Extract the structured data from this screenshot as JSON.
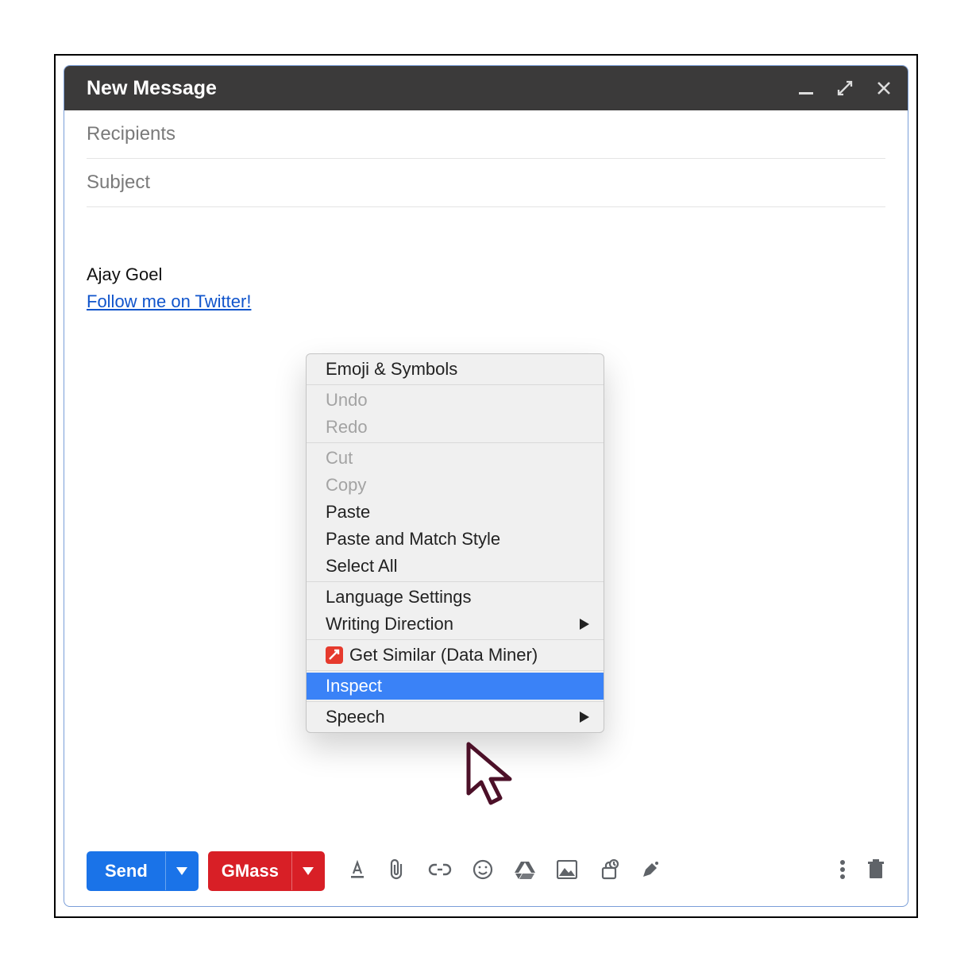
{
  "header": {
    "title": "New Message"
  },
  "fields": {
    "recipients_placeholder": "Recipients",
    "subject_placeholder": "Subject"
  },
  "signature": {
    "name": "Ajay Goel",
    "twitter_link_text": "Follow me on Twitter!"
  },
  "context_menu": {
    "items": {
      "emoji_symbols": "Emoji & Symbols",
      "undo": "Undo",
      "redo": "Redo",
      "cut": "Cut",
      "copy": "Copy",
      "paste": "Paste",
      "paste_match_style": "Paste and Match Style",
      "select_all": "Select All",
      "language_settings": "Language Settings",
      "writing_direction": "Writing Direction",
      "get_similar": "Get Similar (Data Miner)",
      "inspect": "Inspect",
      "speech": "Speech"
    }
  },
  "toolbar": {
    "send_label": "Send",
    "gmass_label": "GMass"
  }
}
